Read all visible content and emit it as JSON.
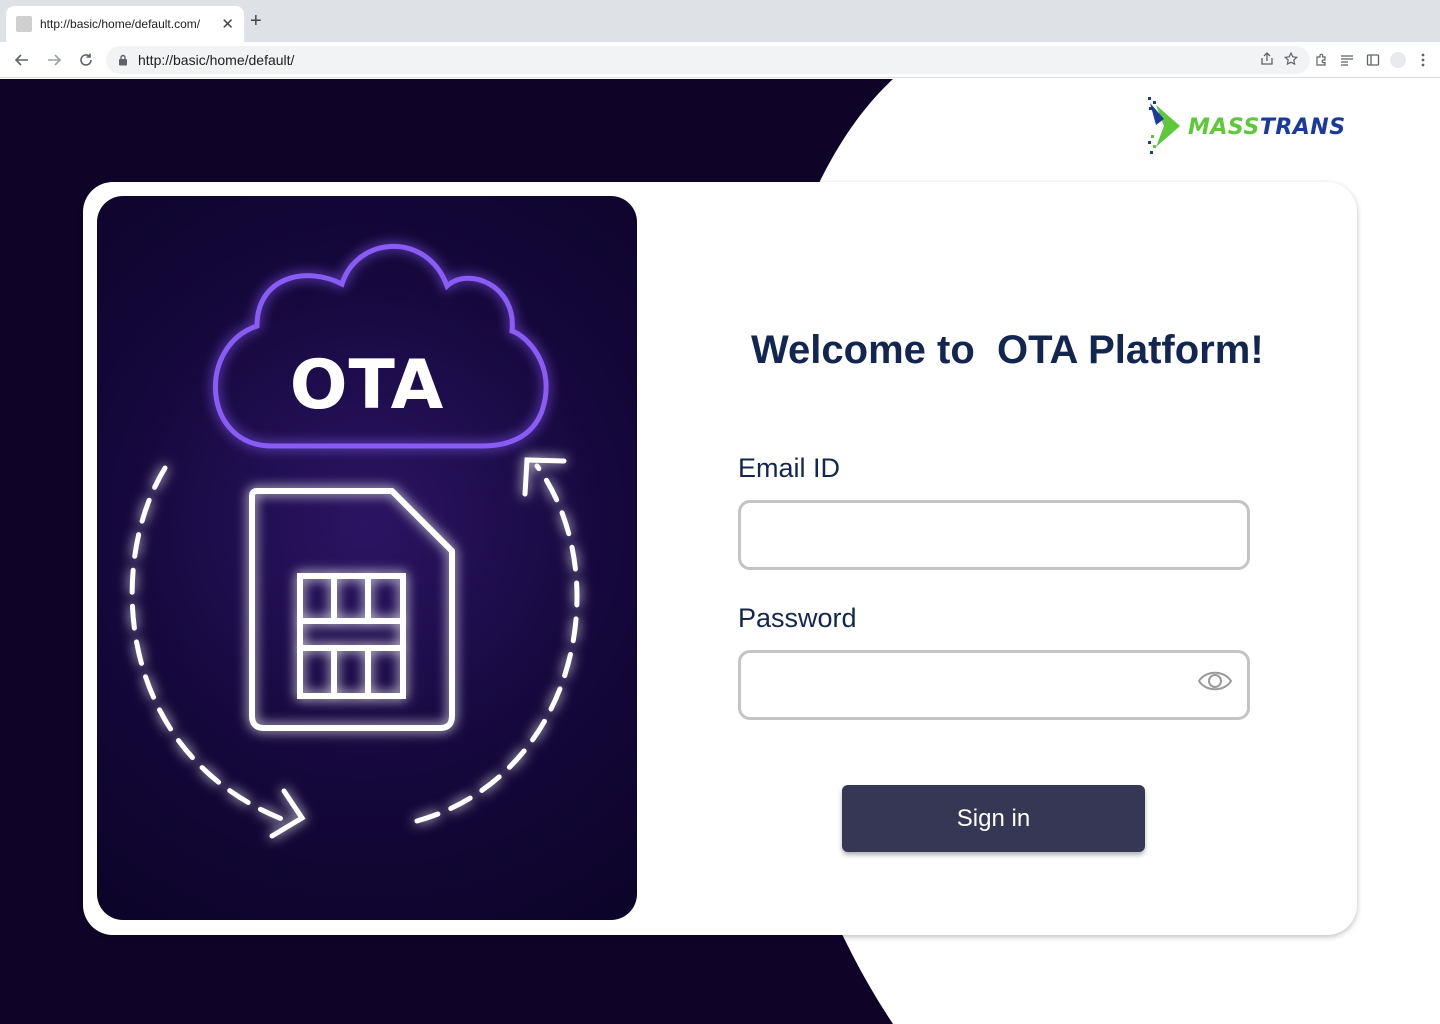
{
  "browser": {
    "tab_title": "http://basic/home/default.com/",
    "url": "http://basic/home/default/",
    "close_glyph": "✕",
    "newtab_glyph": "+"
  },
  "brand": {
    "logo_part1": "MASS",
    "logo_part2": "TRANS",
    "logo_colors": {
      "green": "#5ec73a",
      "blue": "#1a3a9c"
    }
  },
  "hero": {
    "cloud_label": "OTA",
    "icons": [
      "cloud-icon",
      "sim-card-icon",
      "sync-arrows-icon"
    ]
  },
  "login": {
    "heading": "Welcome to  OTA Platform!",
    "email_label": "Email ID",
    "email_value": "",
    "password_label": "Password",
    "password_value": "",
    "submit_label": "Sign in"
  },
  "colors": {
    "page_background": "#0f0428",
    "heading_text": "#12264f",
    "button_background": "#353755",
    "cloud_glow": "#8a5cf6"
  }
}
